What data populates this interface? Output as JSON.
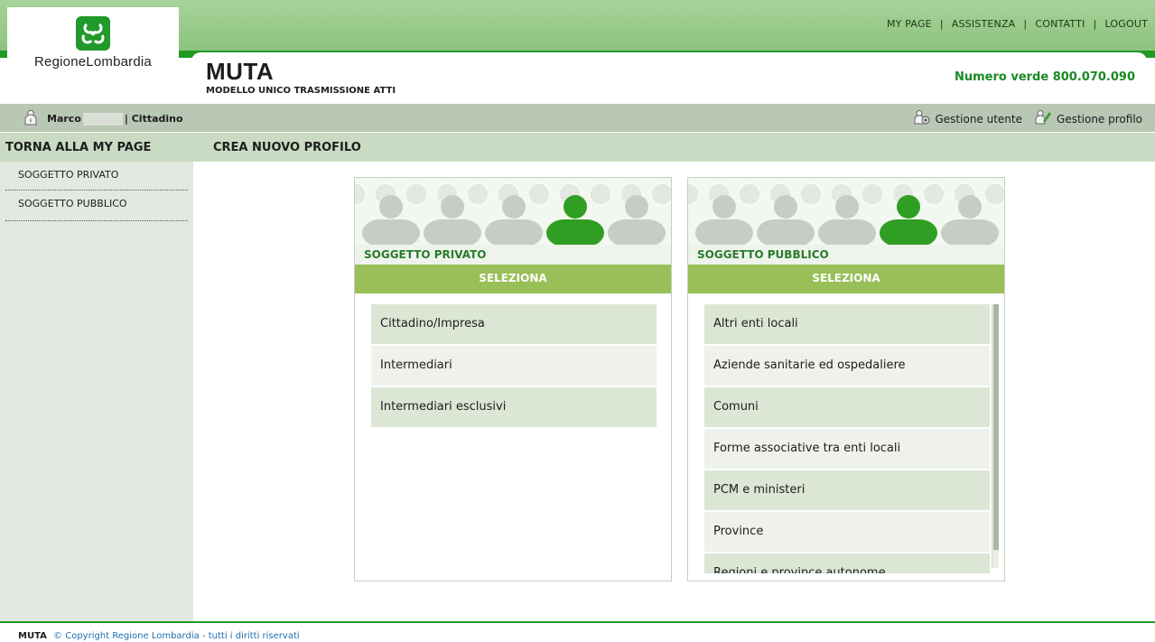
{
  "header": {
    "top_links": [
      "MY PAGE",
      "ASSISTENZA",
      "CONTATTI",
      "LOGOUT"
    ],
    "logo_text": "RegioneLombardia",
    "app_title": "MUTA",
    "app_subtitle": "MODELLO UNICO TRASMISSIONE ATTI",
    "numero_verde": "Numero verde 800.070.090"
  },
  "userbar": {
    "first_name": "Marco",
    "role": "| Cittadino",
    "gestione_utente": "Gestione utente",
    "gestione_profilo": "Gestione profilo"
  },
  "sidebar": {
    "title": "TORNA ALLA MY PAGE",
    "items": [
      "SOGGETTO PRIVATO",
      "SOGGETTO PUBBLICO"
    ]
  },
  "main": {
    "title": "CREA NUOVO PROFILO",
    "panels": [
      {
        "label": "SOGGETTO PRIVATO",
        "select": "SELEZIONA",
        "options": [
          "Cittadino/Impresa",
          "Intermediari",
          "Intermediari esclusivi"
        ]
      },
      {
        "label": "SOGGETTO PUBBLICO",
        "select": "SELEZIONA",
        "options": [
          "Altri enti locali",
          "Aziende sanitarie ed ospedaliere",
          "Comuni",
          "Forme associative tra enti locali",
          "PCM e ministeri",
          "Province",
          "Regioni e province autonome"
        ]
      }
    ]
  },
  "footer": {
    "app": "MUTA",
    "copyright": "© Copyright Regione Lombardia - tutti i diritti riservati"
  },
  "colors": {
    "brand_green": "#1f9a24",
    "select_green": "#99bf58",
    "label_green": "#2b7a2b"
  }
}
